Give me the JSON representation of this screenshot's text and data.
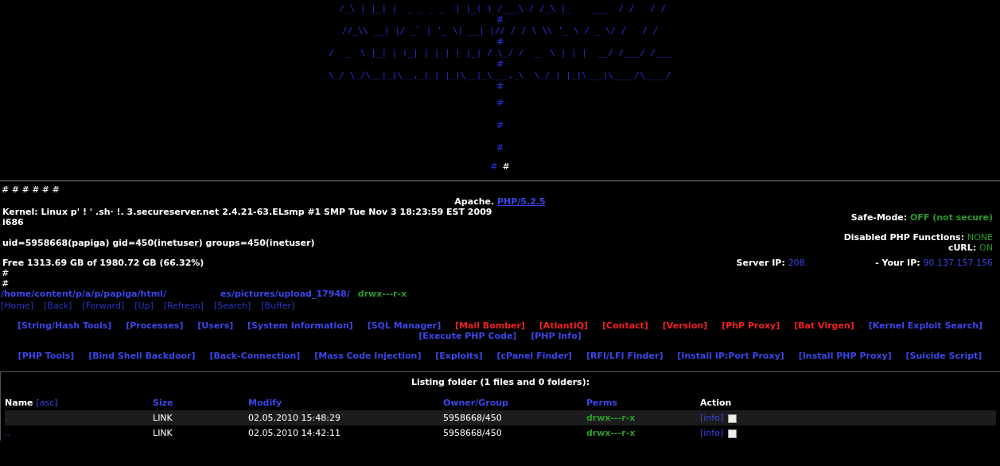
{
  "banner": {
    "art_rows": [
      {
        "kind": "art",
        "text": " /_\\ | |_| |  _ _ _ _  | |_( ) /___\\ / /_\\ |_    ___  / /   / /"
      },
      {
        "kind": "hash",
        "text": "#"
      },
      {
        "kind": "art",
        "text": "//_\\\\ __| |/ _` | '_ \\| __| |// / / \\ \\\\ '_ \\ / _ \\/ /   / /"
      },
      {
        "kind": "hash",
        "text": "#"
      },
      {
        "kind": "art",
        "text": "/  _  \\ |_| | (_| | | | | |_| / \\_/ /  _  \\ | | |  __/ /___/ /___"
      },
      {
        "kind": "hash",
        "text": "#"
      },
      {
        "kind": "art",
        "text": "\\_/ \\_/\\__|_|\\__,_|_| |_|\\__|_\\___,_\\  \\_/_| |_|\\___|\\____/\\____/"
      },
      {
        "kind": "hash",
        "text": "#"
      }
    ],
    "tail_hashes": [
      "#",
      "#",
      "#"
    ],
    "end_marks": [
      "#",
      "#"
    ]
  },
  "hash_row": "# # # # # #",
  "server": {
    "label": "Apache.",
    "php_link": "PHP/5.2.5"
  },
  "kernel": "Kernel: Linux p' !  ' .sh· !. 3.secureserver.net 2.4.21-63.ELsmp #1 SMP Tue Nov 3 18:23:59 EST 2009 i686",
  "uid": "uid=5958668(papiga) gid=450(inetuser) groups=450(inetuser)",
  "free": "Free 1313.69 GB of 1980.72 GB (66.32%)",
  "safe_mode": {
    "label": "Safe-Mode:",
    "value": "OFF (not secure)"
  },
  "disabled_functions": {
    "label": "Disabled PHP Functions:",
    "value": "NONE"
  },
  "curl": {
    "label": "cURL:",
    "value": "ON"
  },
  "server_ip": {
    "label": "Server IP:",
    "value": "208."
  },
  "your_ip": {
    "label": "- Your IP:",
    "value": "90.137.157.156"
  },
  "hash_lines": [
    "#",
    "#"
  ],
  "path": {
    "start": "/home/content/p/a/p/papiga/html/",
    "end": "es/pictures/upload_17948/",
    "perms": "drwx---r-x"
  },
  "nav": [
    "[Home]",
    "[Back]",
    "[Forward]",
    "[Up]",
    "[Refresn]",
    "[Search]",
    "[Buffer]"
  ],
  "tool_rows": [
    [
      {
        "label": "[String/Hash Tools]",
        "color": "#3c46e6"
      },
      {
        "label": "[Processes]",
        "color": "#3c46e6"
      },
      {
        "label": "[Users]",
        "color": "#3c46e6"
      },
      {
        "label": "[System Information]",
        "color": "#3c46e6"
      },
      {
        "label": "[SQL Manager]",
        "color": "#3c46e6"
      },
      {
        "label": "[Mail Bomber]",
        "color": "#f02020"
      },
      {
        "label": "[AtlantiQ]",
        "color": "#f02020"
      },
      {
        "label": "[Contact]",
        "color": "#f02020"
      },
      {
        "label": "[Version]",
        "color": "#f02020"
      },
      {
        "label": "[PhP Proxy]",
        "color": "#f02020"
      },
      {
        "label": "[Bat Virgen]",
        "color": "#f02020"
      },
      {
        "label": "[Kernel Exploit Search]",
        "color": "#3c46e6"
      },
      {
        "label": "[Execute PHP Code]",
        "color": "#3c46e6"
      },
      {
        "label": "[PHP Info]",
        "color": "#3c46e6"
      }
    ],
    [
      {
        "label": "[PHP Tools]",
        "color": "#3c46e6"
      },
      {
        "label": "[Bind Shell Backdoor]",
        "color": "#3c46e6"
      },
      {
        "label": "[Back-Connection]",
        "color": "#3c46e6"
      },
      {
        "label": "[Mass Code Injection]",
        "color": "#3c46e6"
      },
      {
        "label": "[Exploits]",
        "color": "#3c46e6"
      },
      {
        "label": "[cPanel Finder]",
        "color": "#3c46e6"
      },
      {
        "label": "[RFI/LFI Finder]",
        "color": "#3c46e6"
      },
      {
        "label": "[Install IP:Port Proxy]",
        "color": "#3c46e6"
      },
      {
        "label": "[Install PHP Proxy]",
        "color": "#3c46e6"
      },
      {
        "label": "[Suicide Script]",
        "color": "#3c46e6"
      }
    ]
  ],
  "listing": {
    "title": "Listing folder (1 files and 0 folders):",
    "columns": [
      "Name",
      "Size",
      "Modify",
      "Owner/Group",
      "Perms",
      "Action"
    ],
    "sort_link": "[asc]",
    "rows": [
      {
        "name": ".",
        "size": "LINK",
        "modify": "02.05.2010 15:48:29",
        "owner": "5958668/450",
        "perms": "drwx---r-x",
        "action": "[info]",
        "checked": false
      },
      {
        "name": "..",
        "size": "LINK",
        "modify": "02.05.2010 14:42:11",
        "owner": "5958668/450",
        "perms": "drwx---r-x",
        "action": "[info]",
        "checked": false
      }
    ]
  }
}
